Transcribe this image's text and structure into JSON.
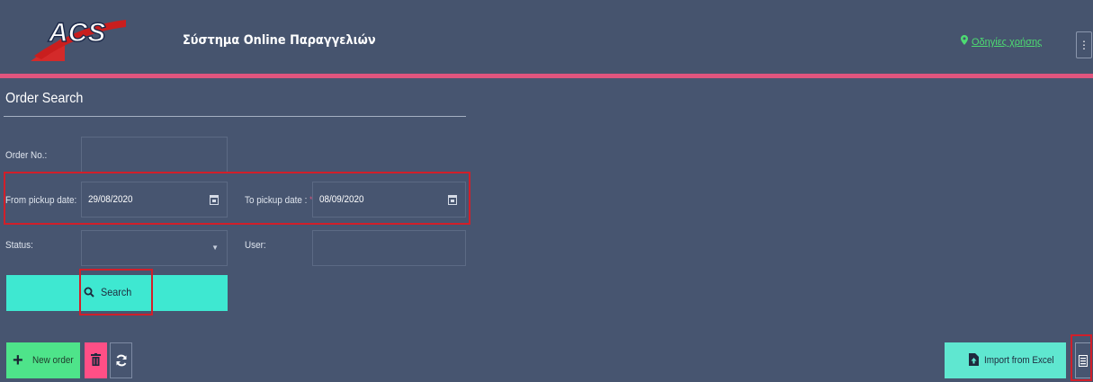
{
  "header": {
    "logo_text": "ACS",
    "app_title": "Σύστημα Online Παραγγελιών",
    "help_link": "Οδηγίες χρήσης",
    "menu_icon": "kebab-menu-icon",
    "accent_line_color": "#e0557e"
  },
  "section": {
    "title": "Order Search"
  },
  "form": {
    "order_no_label": "Order No.:",
    "order_no_value": "",
    "from_date_label": "From pickup date:",
    "from_date_value": "29/08/2020",
    "to_date_label": "To pickup date :",
    "to_date_required": "*",
    "to_date_value": "08/09/2020",
    "status_label": "Status:",
    "status_value": "",
    "user_label": "User:",
    "user_value": "",
    "search_label": "Search"
  },
  "actions": {
    "new_order_label": "New order",
    "delete_icon": "trash-icon",
    "refresh_icon": "refresh-icon",
    "import_label": "Import from Excel",
    "export_icon": "export-icon"
  },
  "colors": {
    "background": "#475570",
    "search_button": "#3ee8d1",
    "new_order_button": "#4ee48a",
    "delete_button": "#ff4f86",
    "import_button": "#5fe7d0",
    "link": "#4ddc72",
    "highlight": "#d11f2a"
  }
}
